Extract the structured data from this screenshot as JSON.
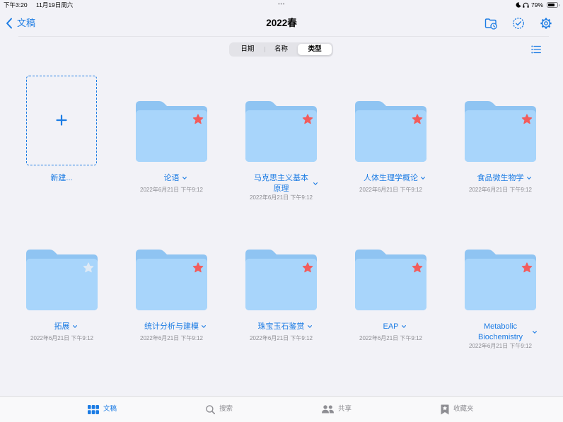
{
  "status_bar": {
    "time": "下午3:20",
    "date": "11月19日周六",
    "center_dots": "•••",
    "battery_percent": "79%",
    "icons": [
      "moon-icon",
      "headphones-icon",
      "battery-icon"
    ]
  },
  "nav": {
    "back_label": "文稿",
    "title": "2022春",
    "actions": [
      "folder-clock-icon",
      "select-check-icon",
      "gear-icon"
    ]
  },
  "sort_control": {
    "options": [
      "日期",
      "名称",
      "类型"
    ],
    "selected_index": 2
  },
  "view_toggle_icon": "list-icon",
  "new_item": {
    "label": "新建...",
    "icon": "plus-icon"
  },
  "folders": [
    {
      "name": "论语",
      "date": "2022年6月21日 下午9:12",
      "starred": true
    },
    {
      "name": "马克思主义基本原理",
      "date": "2022年6月21日 下午9:12",
      "starred": true
    },
    {
      "name": "人体生理学概论",
      "date": "2022年6月21日 下午9:12",
      "starred": true
    },
    {
      "name": "食品微生物学",
      "date": "2022年6月21日 下午9:12",
      "starred": true
    },
    {
      "name": "拓展",
      "date": "2022年6月21日 下午9:12",
      "starred": false
    },
    {
      "name": "统计分析与建模",
      "date": "2022年6月21日 下午9:12",
      "starred": true
    },
    {
      "name": "珠宝玉石鉴赏",
      "date": "2022年6月21日 下午9:12",
      "starred": true
    },
    {
      "name": "EAP",
      "date": "2022年6月21日 下午9:12",
      "starred": true
    },
    {
      "name": "Metabolic Biochemistry",
      "date": "2022年6月21日 下午9:12",
      "starred": true
    }
  ],
  "tab_bar": {
    "items": [
      {
        "label": "文稿",
        "icon": "grid-icon",
        "selected": true
      },
      {
        "label": "搜索",
        "icon": "search-icon",
        "selected": false
      },
      {
        "label": "共享",
        "icon": "people-icon",
        "selected": false
      },
      {
        "label": "收藏夹",
        "icon": "bookmark-star-icon",
        "selected": false
      }
    ]
  },
  "colors": {
    "accent": "#1c7ce4",
    "background": "#f2f2f7",
    "folder_front": "#a8d5fb",
    "folder_back": "#8fc4f2",
    "star_active": "#f25c5c",
    "star_inactive": "#dfeaf5",
    "secondary_text": "#8e8e93"
  }
}
